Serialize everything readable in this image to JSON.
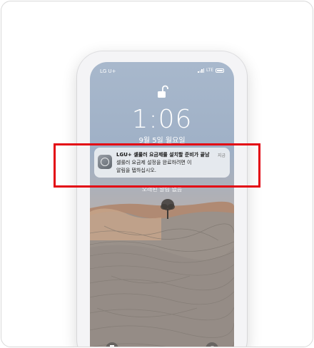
{
  "status_bar": {
    "carrier": "LG U+",
    "network": "LTE"
  },
  "lock_screen": {
    "time": "1:06",
    "date": "9월 5일 월요일",
    "no_older_notifications": "오래된 알림 없음"
  },
  "notification": {
    "icon": "settings-gear-icon",
    "title": "LGU+ 셀룰러 요금제를 설치할 준비가 끝남",
    "time": "지금",
    "body_line1": "셀룰러 요금제 설정을 완료하려면 이",
    "body_line2": "알림을 탭하십시오."
  },
  "quick_actions": {
    "left_icon": "flashlight-icon",
    "right_icon": "camera-icon"
  },
  "colors": {
    "highlight_box": "#e30613",
    "sky": "#a8b8cc",
    "rock": "#8c857d"
  }
}
